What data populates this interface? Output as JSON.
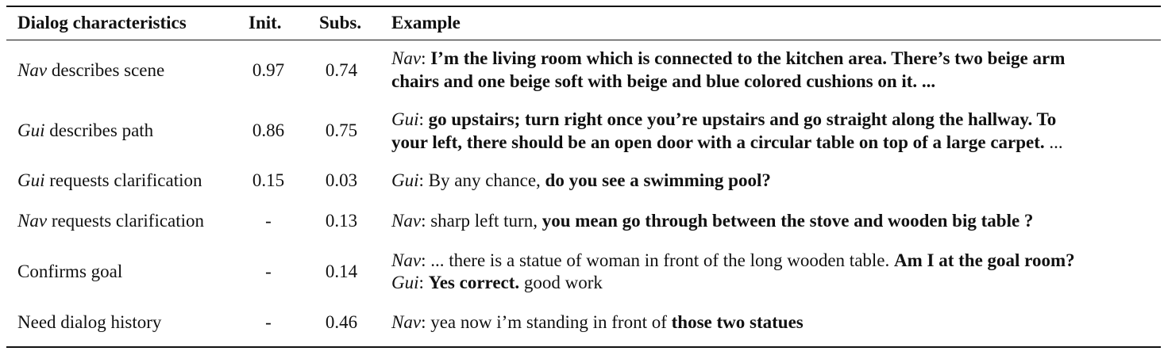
{
  "headers": {
    "characteristics": "Dialog characteristics",
    "init": "Init.",
    "subs": "Subs.",
    "example": "Example"
  },
  "rows": [
    {
      "char_italic": "Nav",
      "char_rest": " describes scene",
      "init": "0.97",
      "subs": "0.74",
      "lines": [
        {
          "speaker": "Nav",
          "sep": ": ",
          "normal_pre": "",
          "bold": "I’m the living room which is connected to the kitchen area. There’s two beige arm",
          "normal_post": ""
        },
        {
          "speaker": "",
          "sep": "",
          "normal_pre": "",
          "bold": "chairs and one beige soft with beige and blue colored cushions on it. ...",
          "normal_post": ""
        }
      ]
    },
    {
      "char_italic": "Gui",
      "char_rest": " describes path",
      "init": "0.86",
      "subs": "0.75",
      "lines": [
        {
          "speaker": "Gui",
          "sep": ": ",
          "normal_pre": "",
          "bold": "go upstairs; turn right once you’re upstairs and go straight along the hallway. To",
          "normal_post": ""
        },
        {
          "speaker": "",
          "sep": "",
          "normal_pre": "",
          "bold": "your left, there should be an open door with a circular table on top of a large carpet.",
          "normal_post": " ..."
        }
      ]
    },
    {
      "char_italic": "Gui",
      "char_rest": " requests clarification",
      "init": "0.15",
      "subs": "0.03",
      "lines": [
        {
          "speaker": "Gui",
          "sep": ": ",
          "normal_pre": "By any chance, ",
          "bold": "do you see a swimming pool?",
          "normal_post": ""
        }
      ]
    },
    {
      "char_italic": "Nav",
      "char_rest": " requests clarification",
      "init": "-",
      "subs": "0.13",
      "lines": [
        {
          "speaker": "Nav",
          "sep": ": ",
          "normal_pre": "sharp left turn, ",
          "bold": "you mean go through between the stove and wooden big table ?",
          "normal_post": ""
        }
      ]
    },
    {
      "char_italic": "",
      "char_rest": "Confirms goal",
      "init": "-",
      "subs": "0.14",
      "lines": [
        {
          "speaker": "Nav",
          "sep": ": ",
          "normal_pre": "... there is a statue of woman in front of the long wooden table. ",
          "bold": "Am I at the goal room?",
          "normal_post": ""
        },
        {
          "speaker": "Gui",
          "sep": ": ",
          "normal_pre": "",
          "bold": "Yes correct.",
          "normal_post": " good work"
        }
      ]
    },
    {
      "char_italic": "",
      "char_rest": "Need dialog history",
      "init": "-",
      "subs": "0.46",
      "lines": [
        {
          "speaker": "Nav",
          "sep": ": ",
          "normal_pre": "yea now i’m standing in front of ",
          "bold": "those two statues",
          "normal_post": ""
        }
      ]
    }
  ]
}
